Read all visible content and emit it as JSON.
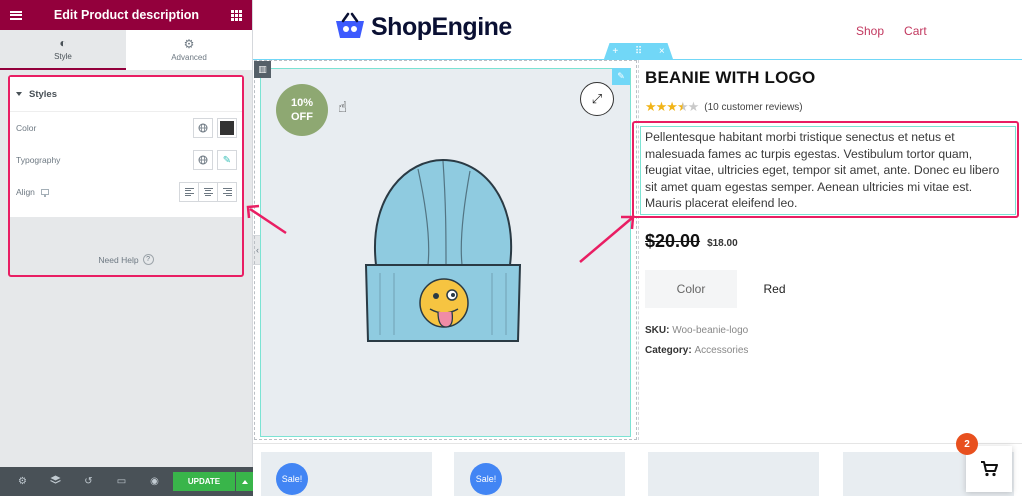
{
  "panel": {
    "header_title": "Edit Product description",
    "tabs": [
      {
        "label": "Style",
        "icon": "half-circle-icon",
        "active": true
      },
      {
        "label": "Advanced",
        "icon": "gear-icon",
        "active": false
      }
    ],
    "section_title": "Styles",
    "controls": {
      "color_label": "Color",
      "typography_label": "Typography",
      "align_label": "Align"
    },
    "need_help": "Need Help",
    "update_label": "UPDATE"
  },
  "site": {
    "logo_text": "ShopEngine",
    "nav": [
      "Shop",
      "Cart"
    ]
  },
  "product": {
    "sale_line1": "10%",
    "sale_line2": "OFF",
    "title": "BEANIE WITH LOGO",
    "rating_stars": 3.5,
    "reviews": "(10 customer reviews)",
    "description": "Pellentesque habitant morbi tristique senectus et netus et malesuada fames ac turpis egestas. Vestibulum tortor quam, feugiat vitae, ultricies eget, tempor sit amet, ante. Donec eu libero sit amet quam egestas semper. Aenean ultricies mi vitae est. Mauris placerat eleifend leo.",
    "old_price": "$20.00",
    "new_price": "$18.00",
    "variation_label": "Color",
    "variation_value": "Red",
    "sku_label": "SKU:",
    "sku_value": "Woo-beanie-logo",
    "category_label": "Category:",
    "category_value": "Accessories"
  },
  "related": {
    "sale_badge": "Sale!"
  },
  "cart": {
    "count": "2"
  },
  "colors": {
    "panel_header": "#93003c",
    "highlight": "#e91e63",
    "accent_nav": "#c2385f",
    "update_button": "#39b54a",
    "editor_blue": "#71d7f7",
    "sale_bubble": "#8ea872",
    "cart_badge": "#e8501e"
  }
}
